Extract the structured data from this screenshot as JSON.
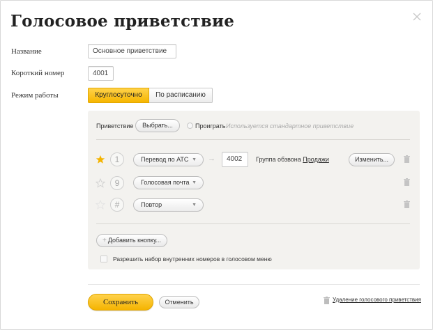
{
  "dialog": {
    "title": "Голосовое приветствие"
  },
  "form": {
    "name_label": "Название",
    "name_value": "Основное приветствие",
    "short_number_label": "Короткий номер",
    "short_number_value": "4001",
    "mode_label": "Режим работы",
    "mode_options": [
      {
        "label": "Круглосуточно",
        "selected": true
      },
      {
        "label": "По расписанию",
        "selected": false
      }
    ]
  },
  "greeting": {
    "label": "Приветствие",
    "choose_button": "Выбрать...",
    "play_label": "Проиграть",
    "standard_note": "Используется стандартное приветствие"
  },
  "menu_rows": [
    {
      "key": "1",
      "starred": true,
      "action": "Перевод по АТС",
      "number": "4002",
      "group_label": "Группа обзвона",
      "group_link": "Продажи",
      "edit_button": "Изменить..."
    },
    {
      "key": "9",
      "starred": false,
      "action": "Голосовая почта"
    },
    {
      "key": "#",
      "starred": false,
      "action": "Повтор"
    }
  ],
  "panel_footer": {
    "add_button": "Добавить кнопку...",
    "allow_internal_label": "Разрешить набор внутренних номеров в голосовом меню"
  },
  "footer": {
    "save_button": "Сохранить",
    "cancel_button": "Отменить",
    "delete_link": "Удаление голосового приветствия"
  },
  "colors": {
    "accent": "#f6b600",
    "panel_bg": "#f3f2ef"
  },
  "icons": {
    "close": "close-icon",
    "star": "star-icon",
    "trash": "trash-icon",
    "arrow": "arrow-right-icon",
    "plus": "plus-icon",
    "caret": "chevron-down-icon"
  }
}
